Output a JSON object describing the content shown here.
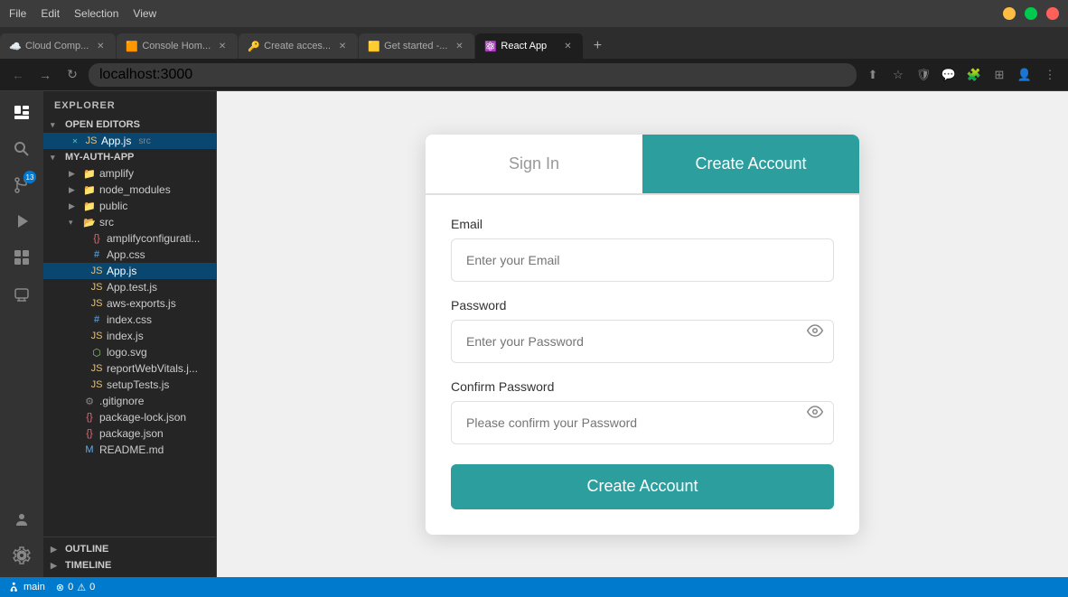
{
  "titleBar": {
    "menuItems": [
      "File",
      "Edit",
      "Selection",
      "View"
    ]
  },
  "tabs": [
    {
      "id": "tab1",
      "label": "Cloud Comp...",
      "active": false,
      "favicon": "☁️"
    },
    {
      "id": "tab2",
      "label": "Console Hom...",
      "active": false,
      "favicon": "🟧"
    },
    {
      "id": "tab3",
      "label": "Create acces...",
      "active": false,
      "favicon": "🔑"
    },
    {
      "id": "tab4",
      "label": "Get started -...",
      "active": false,
      "favicon": "🟨"
    },
    {
      "id": "tab5",
      "label": "React App",
      "active": true,
      "favicon": "⚛️"
    }
  ],
  "addressBar": {
    "url": "localhost:3000"
  },
  "explorer": {
    "title": "EXPLORER",
    "sections": {
      "openEditors": "OPEN EDITORS",
      "project": "MY-AUTH-APP"
    }
  },
  "openFiles": [
    {
      "name": "App.js",
      "path": "src",
      "type": "js",
      "modified": true
    }
  ],
  "fileTree": [
    {
      "name": "amplify",
      "type": "folder",
      "indent": 1
    },
    {
      "name": "node_modules",
      "type": "folder",
      "indent": 1
    },
    {
      "name": "public",
      "type": "folder",
      "indent": 1
    },
    {
      "name": "src",
      "type": "folder",
      "indent": 1,
      "open": true
    },
    {
      "name": "amplifyconfigurati...",
      "type": "json",
      "indent": 2
    },
    {
      "name": "App.css",
      "type": "css",
      "indent": 2
    },
    {
      "name": "App.js",
      "type": "js",
      "indent": 2,
      "active": true
    },
    {
      "name": "App.test.js",
      "type": "js",
      "indent": 2
    },
    {
      "name": "aws-exports.js",
      "type": "js",
      "indent": 2
    },
    {
      "name": "index.css",
      "type": "css",
      "indent": 2
    },
    {
      "name": "index.js",
      "type": "js",
      "indent": 2
    },
    {
      "name": "logo.svg",
      "type": "svg",
      "indent": 2
    },
    {
      "name": "reportWebVitals.js",
      "type": "js",
      "indent": 2
    },
    {
      "name": "setupTests.js",
      "type": "js",
      "indent": 2
    },
    {
      "name": ".gitignore",
      "type": "gitignore",
      "indent": 1
    },
    {
      "name": "package-lock.json",
      "type": "json",
      "indent": 1
    },
    {
      "name": "package.json",
      "type": "json",
      "indent": 1
    },
    {
      "name": "README.md",
      "type": "md",
      "indent": 1
    }
  ],
  "authCard": {
    "tabs": [
      "Sign In",
      "Create Account"
    ],
    "activeTab": 1,
    "fields": {
      "email": {
        "label": "Email",
        "placeholder": "Enter your Email"
      },
      "password": {
        "label": "Password",
        "placeholder": "Enter your Password"
      },
      "confirmPassword": {
        "label": "Confirm Password",
        "placeholder": "Please confirm your Password"
      }
    },
    "submitButton": "Create Account"
  },
  "statusBar": {
    "branch": "main",
    "errors": "0",
    "warnings": "0"
  },
  "outlineSection": "OUTLINE",
  "timelineSection": "TIMELINE"
}
